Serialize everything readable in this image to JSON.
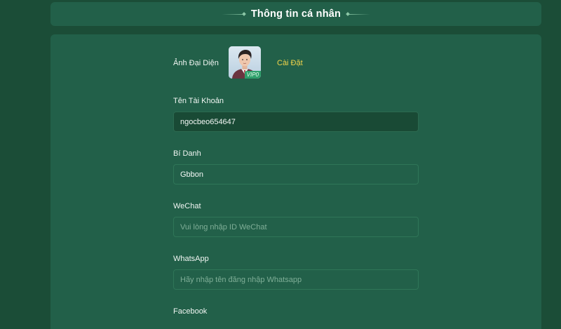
{
  "header": {
    "title": "Thông tin cá nhân"
  },
  "profile": {
    "avatar_label": "Ảnh Đại Diện",
    "avatar_badge": "VIP0",
    "settings_link": "Cài Đặt"
  },
  "fields": {
    "account_name": {
      "label": "Tên Tài Khoản",
      "value": "ngocbeo654647"
    },
    "nickname": {
      "label": "Bí Danh",
      "value": "Gbbon"
    },
    "wechat": {
      "label": "WeChat",
      "value": "",
      "placeholder": "Vui lòng nhập ID WeChat"
    },
    "whatsapp": {
      "label": "WhatsApp",
      "value": "",
      "placeholder": "Hãy nhập tên đăng nhập Whatsapp"
    },
    "facebook": {
      "label": "Facebook"
    }
  },
  "colors": {
    "page_background": "#1b4d37",
    "card_background": "#226049",
    "filled_field_background": "#194a35",
    "field_border": "#2f7658",
    "link_accent": "#f2d44a",
    "vip_badge": "#2fa06c"
  }
}
